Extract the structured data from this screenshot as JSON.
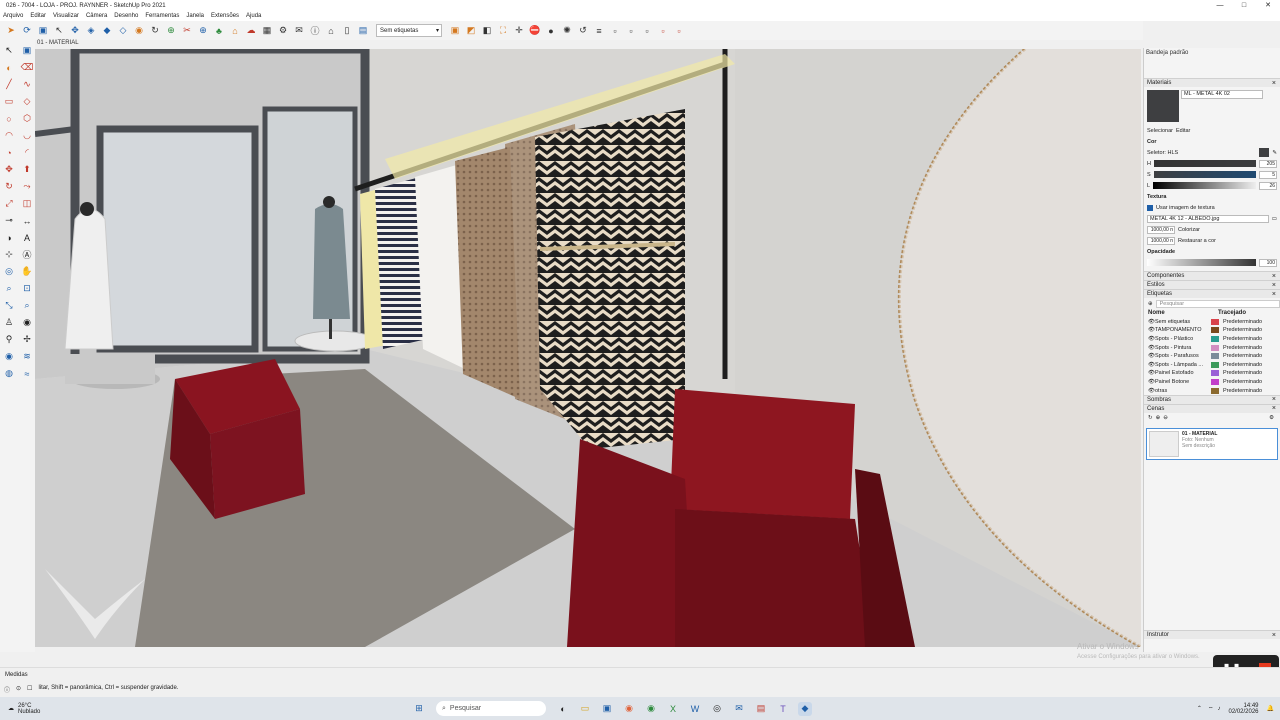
{
  "window": {
    "title": "026 - 7004 - LOJA - PROJ. RAYNNER - SketchUp Pro 2021",
    "min": "—",
    "max": "□",
    "close": "✕"
  },
  "menu": [
    "Arquivo",
    "Editar",
    "Visualizar",
    "Câmera",
    "Desenho",
    "Ferramentas",
    "Janela",
    "Extensões",
    "Ajuda"
  ],
  "toolbar": {
    "tag_selector": "Sem etiquetas"
  },
  "scene_tab": "01 - MATERIAL",
  "tray": {
    "title": "Bandeja padrão",
    "materials_header": "Materiais",
    "material_name": "ML - METAL 4K 02",
    "select_label": "Selecionar",
    "edit_label": "Editar",
    "color_label": "Cor",
    "selector_label": "Seletor: HLS",
    "h_value": "205",
    "s_value": "5",
    "l_value": "26",
    "texture_label": "Textura",
    "use_texture": "Usar imagem de textura",
    "texture_file": "METAL 4K 12 - ALBEDO.jpg",
    "tex_w": "1000,00 n",
    "tex_h": "1000,00 n",
    "colorize": "Colorizar",
    "restore_color": "Restaurar a cor",
    "opacity_label": "Opacidade",
    "opacity_value": "100",
    "components": "Componentes",
    "styles": "Estilos",
    "tags": "Etiquetas",
    "search_placeholder": "Pesquisar",
    "col_name": "Nome",
    "col_dash": "Tracejado",
    "tag_rows": [
      {
        "name": "Sem etiquetas",
        "dash": "Predeterminado",
        "color": "#d9434b"
      },
      {
        "name": "TAMPONAMENTO",
        "dash": "Predeterminado",
        "color": "#7a4a1d"
      },
      {
        "name": "Spots - Plástico",
        "dash": "Predeterminado",
        "color": "#2a9d8f"
      },
      {
        "name": "Spots - Pintura",
        "dash": "Predeterminado",
        "color": "#d28ec1"
      },
      {
        "name": "Spots - Parafusos",
        "dash": "Predeterminado",
        "color": "#7c8c9a"
      },
      {
        "name": "Spots - Lâmpada ...",
        "dash": "Predeterminado",
        "color": "#3b9a5a"
      },
      {
        "name": "Painel Estofado",
        "dash": "Predeterminado",
        "color": "#9a5fd6"
      },
      {
        "name": "Painel Botone",
        "dash": "Predeterminado",
        "color": "#c23fc9"
      },
      {
        "name": "otras",
        "dash": "Predeterminado",
        "color": "#8b6a2e"
      }
    ],
    "shadows": "Sombras",
    "scenes": "Cenas",
    "scene_card": {
      "name": "01 - MATERIAL",
      "line1": "Foto: Nenhum",
      "line2": "Sem descrição"
    },
    "instructor": "Instrutor"
  },
  "status": {
    "measures_label": "Medidas",
    "hint": "litar, Shift = panorâmica, Ctrl = suspender gravidade."
  },
  "watermark": {
    "line1": "Ativar o Windows",
    "line2": "Acesse Configurações para ativar o Windows."
  },
  "taskbar": {
    "weather_temp": "26°C",
    "weather_desc": "Nublado",
    "search": "Pesquisar",
    "time": "14:49",
    "date": "02/02/2026"
  },
  "colors": {
    "armchair": "#8e1620",
    "rug": "#8b8781",
    "floor": "#cfcfcf",
    "accent": "#1f5fa8"
  }
}
